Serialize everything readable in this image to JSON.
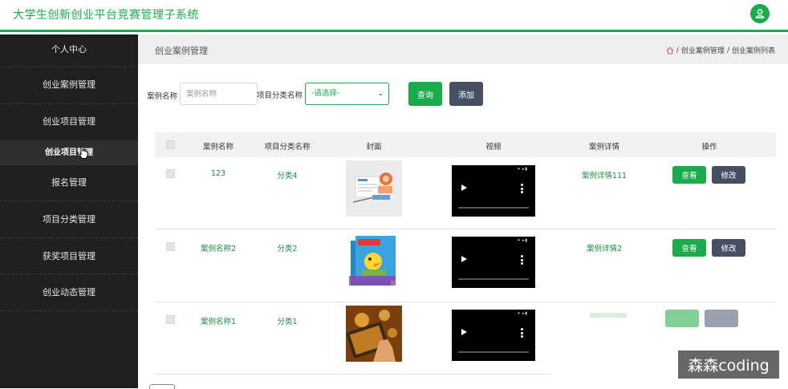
{
  "app": {
    "title": "大学生创新创业平台竞赛管理子系统",
    "accent_color": "#1aab4b",
    "user_icon": "user-icon"
  },
  "sidebar": {
    "items": [
      {
        "label": "个人中心"
      },
      {
        "label": "创业案例管理"
      },
      {
        "label": "创业项目管理"
      },
      {
        "label": "创业项目管理",
        "active": true
      },
      {
        "label": "报名管理"
      },
      {
        "label": "项目分类管理"
      },
      {
        "label": "获奖项目管理"
      },
      {
        "label": "创业动态管理"
      }
    ]
  },
  "header": {
    "page_title": "创业案例管理",
    "breadcrumb": [
      "创业案例管理",
      "创业案例列表"
    ],
    "separator": "/",
    "home_icon": "home-icon"
  },
  "filters": {
    "name_label": "案例名称",
    "name_placeholder": "案例名称",
    "category_label": "项目分类名称",
    "category_selected": "-请选择-",
    "query_button": "查询",
    "add_button": "添加"
  },
  "table": {
    "columns": [
      "",
      "案例名称",
      "项目分类名称",
      "封面",
      "视频",
      "案例详情",
      "操作"
    ],
    "rows": [
      {
        "name": "123",
        "category": "分类4",
        "cover": "news-illustration",
        "detail": "案例详情111",
        "view": "查看",
        "edit": "修改"
      },
      {
        "name": "案例名称2",
        "category": "分类2",
        "cover": "book-cover",
        "detail": "案例详情2",
        "view": "查看",
        "edit": "修改"
      },
      {
        "name": "案例名称1",
        "category": "分类1",
        "cover": "tablet-photo",
        "detail": "",
        "view": "",
        "edit": ""
      }
    ]
  },
  "watermark": "森森coding"
}
